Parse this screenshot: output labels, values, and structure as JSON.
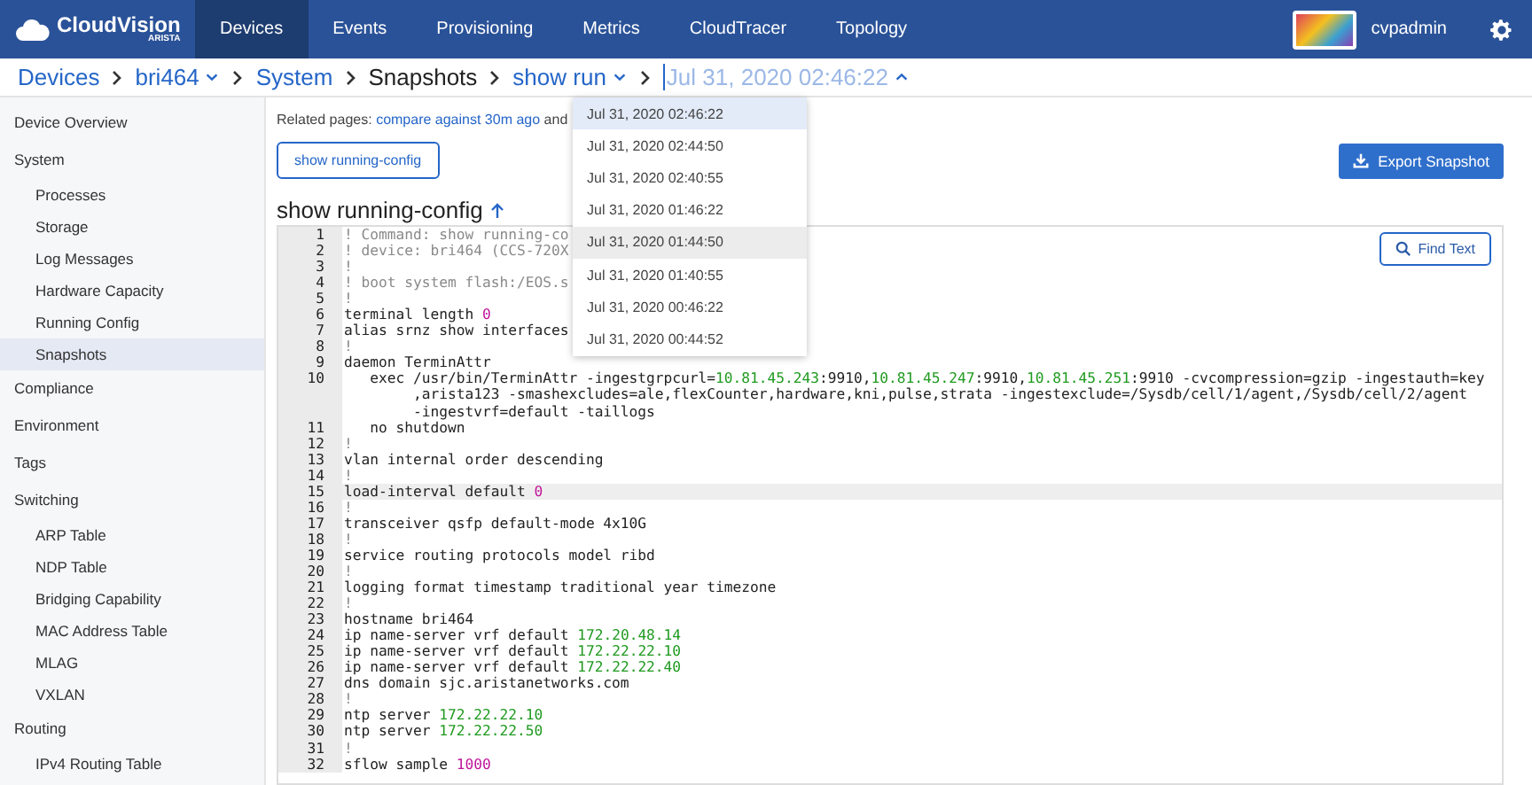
{
  "navbar": {
    "logo": {
      "name": "CloudVision",
      "sub": "ARISTA"
    },
    "tabs": [
      {
        "label": "Devices",
        "selected": true
      },
      {
        "label": "Events",
        "selected": false
      },
      {
        "label": "Provisioning",
        "selected": false
      },
      {
        "label": "Metrics",
        "selected": false
      },
      {
        "label": "CloudTracer",
        "selected": false
      },
      {
        "label": "Topology",
        "selected": false
      }
    ],
    "user": "cvpadmin"
  },
  "breadcrumb": [
    {
      "label": "Devices",
      "kind": "link"
    },
    {
      "label": "bri464",
      "kind": "menu"
    },
    {
      "label": "System",
      "kind": "link"
    },
    {
      "label": "Snapshots",
      "kind": "plain"
    },
    {
      "label": "show run",
      "kind": "menu"
    },
    {
      "label": "Jul 31, 2020 02:46:22",
      "kind": "open"
    }
  ],
  "sidebar": [
    {
      "label": "Device Overview"
    },
    {
      "label": "System",
      "children": [
        {
          "label": "Processes",
          "selected": false
        },
        {
          "label": "Storage",
          "selected": false
        },
        {
          "label": "Log Messages",
          "selected": false
        },
        {
          "label": "Hardware Capacity",
          "selected": false
        },
        {
          "label": "Running Config",
          "selected": false
        },
        {
          "label": "Snapshots",
          "selected": true
        }
      ]
    },
    {
      "label": "Compliance"
    },
    {
      "label": "Environment"
    },
    {
      "label": "Tags"
    },
    {
      "label": "Switching",
      "children": [
        {
          "label": "ARP Table",
          "selected": false
        },
        {
          "label": "NDP Table",
          "selected": false
        },
        {
          "label": "Bridging Capability",
          "selected": false
        },
        {
          "label": "MAC Address Table",
          "selected": false
        },
        {
          "label": "MLAG",
          "selected": false
        },
        {
          "label": "VXLAN",
          "selected": false
        }
      ]
    },
    {
      "label": "Routing",
      "children": [
        {
          "label": "IPv4 Routing Table",
          "selected": false
        }
      ]
    }
  ],
  "related": {
    "label": "Related pages:",
    "link": "compare against 30m ago",
    "tail": "and"
  },
  "command_button": "show running-config",
  "export_button": "Export Snapshot",
  "section_title": "show running-config",
  "find_button": "Find Text",
  "dropdown": [
    {
      "label": "Jul 31, 2020 02:46:22",
      "selected": true,
      "hovered": false
    },
    {
      "label": "Jul 31, 2020 02:44:50",
      "selected": false,
      "hovered": false
    },
    {
      "label": "Jul 31, 2020 02:40:55",
      "selected": false,
      "hovered": false
    },
    {
      "label": "Jul 31, 2020 01:46:22",
      "selected": false,
      "hovered": false
    },
    {
      "label": "Jul 31, 2020 01:44:50",
      "selected": false,
      "hovered": true
    },
    {
      "label": "Jul 31, 2020 01:40:55",
      "selected": false,
      "hovered": false
    },
    {
      "label": "Jul 31, 2020 00:46:22",
      "selected": false,
      "hovered": false
    },
    {
      "label": "Jul 31, 2020 00:44:52",
      "selected": false,
      "hovered": false
    }
  ],
  "code": [
    {
      "number": "1",
      "active": false,
      "rows": [
        [
          {
            "text": "! Command: show running-co",
            "kind": "comment"
          }
        ]
      ]
    },
    {
      "number": "2",
      "active": false,
      "rows": [
        [
          {
            "text": "! device: bri464 (CCS-720X",
            "kind": "comment"
          }
        ]
      ]
    },
    {
      "number": "3",
      "active": false,
      "rows": [
        [
          {
            "text": "!",
            "kind": "comment"
          }
        ]
      ]
    },
    {
      "number": "4",
      "active": false,
      "rows": [
        [
          {
            "text": "! boot system flash:/EOS.s",
            "kind": "comment"
          }
        ]
      ]
    },
    {
      "number": "5",
      "active": false,
      "rows": [
        [
          {
            "text": "!",
            "kind": "comment"
          }
        ]
      ]
    },
    {
      "number": "6",
      "active": false,
      "rows": [
        [
          {
            "text": "terminal length ",
            "kind": "plain"
          },
          {
            "text": "0",
            "kind": "number"
          }
        ]
      ]
    },
    {
      "number": "7",
      "active": false,
      "rows": [
        [
          {
            "text": "alias srnz show interfaces",
            "kind": "plain"
          }
        ]
      ]
    },
    {
      "number": "8",
      "active": false,
      "rows": [
        [
          {
            "text": "!",
            "kind": "comment"
          }
        ]
      ]
    },
    {
      "number": "9",
      "active": false,
      "rows": [
        [
          {
            "text": "daemon TerminAttr",
            "kind": "plain"
          }
        ]
      ]
    },
    {
      "number": "10",
      "active": false,
      "rows": [
        [
          {
            "text": "   exec /usr/bin/TerminAttr -ingestgrpcurl=",
            "kind": "plain"
          },
          {
            "text": "10.81.45.243",
            "kind": "address"
          },
          {
            "text": ":9910,",
            "kind": "plain"
          },
          {
            "text": "10.81.45.247",
            "kind": "address"
          },
          {
            "text": ":9910,",
            "kind": "plain"
          },
          {
            "text": "10.81.45.251",
            "kind": "address"
          },
          {
            "text": ":9910 -cvcompression=gzip -ingestauth=key",
            "kind": "plain"
          }
        ],
        [
          {
            "text": "        ,arista123 -smashexcludes=ale,flexCounter,hardware,kni,pulse,strata -ingestexclude=/Sysdb/cell/1/agent,/Sysdb/cell/2/agent",
            "kind": "plain"
          }
        ],
        [
          {
            "text": "        -ingestvrf=default -taillogs",
            "kind": "plain"
          }
        ]
      ]
    },
    {
      "number": "11",
      "active": false,
      "rows": [
        [
          {
            "text": "   no shutdown",
            "kind": "plain"
          }
        ]
      ]
    },
    {
      "number": "12",
      "active": false,
      "rows": [
        [
          {
            "text": "!",
            "kind": "comment"
          }
        ]
      ]
    },
    {
      "number": "13",
      "active": false,
      "rows": [
        [
          {
            "text": "vlan internal order descending",
            "kind": "plain"
          }
        ]
      ]
    },
    {
      "number": "14",
      "active": false,
      "rows": [
        [
          {
            "text": "!",
            "kind": "comment"
          }
        ]
      ]
    },
    {
      "number": "15",
      "active": true,
      "rows": [
        [
          {
            "text": "load-interval default ",
            "kind": "plain"
          },
          {
            "text": "0",
            "kind": "number"
          }
        ]
      ]
    },
    {
      "number": "16",
      "active": false,
      "rows": [
        [
          {
            "text": "!",
            "kind": "comment"
          }
        ]
      ]
    },
    {
      "number": "17",
      "active": false,
      "rows": [
        [
          {
            "text": "transceiver qsfp default-mode 4x10G",
            "kind": "plain"
          }
        ]
      ]
    },
    {
      "number": "18",
      "active": false,
      "rows": [
        [
          {
            "text": "!",
            "kind": "comment"
          }
        ]
      ]
    },
    {
      "number": "19",
      "active": false,
      "rows": [
        [
          {
            "text": "service routing protocols model ribd",
            "kind": "plain"
          }
        ]
      ]
    },
    {
      "number": "20",
      "active": false,
      "rows": [
        [
          {
            "text": "!",
            "kind": "comment"
          }
        ]
      ]
    },
    {
      "number": "21",
      "active": false,
      "rows": [
        [
          {
            "text": "logging format timestamp traditional year timezone",
            "kind": "plain"
          }
        ]
      ]
    },
    {
      "number": "22",
      "active": false,
      "rows": [
        [
          {
            "text": "!",
            "kind": "comment"
          }
        ]
      ]
    },
    {
      "number": "23",
      "active": false,
      "rows": [
        [
          {
            "text": "hostname bri464",
            "kind": "plain"
          }
        ]
      ]
    },
    {
      "number": "24",
      "active": false,
      "rows": [
        [
          {
            "text": "ip name-server vrf default ",
            "kind": "plain"
          },
          {
            "text": "172.20.48.14",
            "kind": "address"
          }
        ]
      ]
    },
    {
      "number": "25",
      "active": false,
      "rows": [
        [
          {
            "text": "ip name-server vrf default ",
            "kind": "plain"
          },
          {
            "text": "172.22.22.10",
            "kind": "address"
          }
        ]
      ]
    },
    {
      "number": "26",
      "active": false,
      "rows": [
        [
          {
            "text": "ip name-server vrf default ",
            "kind": "plain"
          },
          {
            "text": "172.22.22.40",
            "kind": "address"
          }
        ]
      ]
    },
    {
      "number": "27",
      "active": false,
      "rows": [
        [
          {
            "text": "dns domain sjc.aristanetworks.com",
            "kind": "plain"
          }
        ]
      ]
    },
    {
      "number": "28",
      "active": false,
      "rows": [
        [
          {
            "text": "!",
            "kind": "comment"
          }
        ]
      ]
    },
    {
      "number": "29",
      "active": false,
      "rows": [
        [
          {
            "text": "ntp server ",
            "kind": "plain"
          },
          {
            "text": "172.22.22.10",
            "kind": "address"
          }
        ]
      ]
    },
    {
      "number": "30",
      "active": false,
      "rows": [
        [
          {
            "text": "ntp server ",
            "kind": "plain"
          },
          {
            "text": "172.22.22.50",
            "kind": "address"
          }
        ]
      ]
    },
    {
      "number": "31",
      "active": false,
      "rows": [
        [
          {
            "text": "!",
            "kind": "comment"
          }
        ]
      ]
    },
    {
      "number": "32",
      "active": false,
      "rows": [
        [
          {
            "text": "sflow sample ",
            "kind": "plain"
          },
          {
            "text": "1000",
            "kind": "number"
          }
        ]
      ]
    }
  ]
}
